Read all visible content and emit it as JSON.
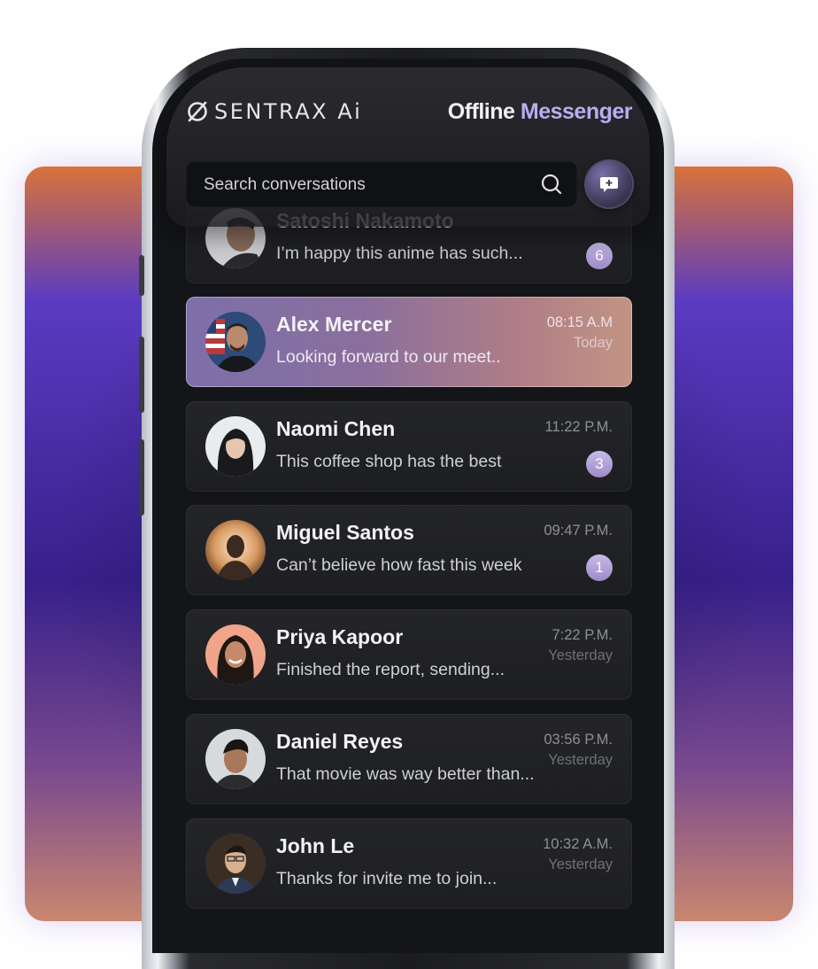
{
  "header": {
    "brand": "SENTRAX Ai",
    "title_part1": "Offline",
    "title_part2": "Messenger"
  },
  "search": {
    "placeholder": "Search conversations"
  },
  "compose": {
    "icon": "chat-plus-icon"
  },
  "colors": {
    "accent": "#b7aef0",
    "badge": "#b3a2d8",
    "active_from": "#7d6faa",
    "active_to": "#c29484"
  },
  "conversations": [
    {
      "name": "Satoshi Nakamoto",
      "message": "I’m happy this anime has such...",
      "time": "",
      "day": "",
      "badge": "6"
    },
    {
      "name": "Alex Mercer",
      "message": "Looking forward to our meet..",
      "time": "08:15 A.M",
      "day": "Today",
      "badge": ""
    },
    {
      "name": "Naomi Chen",
      "message": "This coffee shop has the best",
      "time": "11:22 P.M.",
      "day": "",
      "badge": "3"
    },
    {
      "name": "Miguel Santos",
      "message": "Can’t believe how fast this week",
      "time": "09:47 P.M.",
      "day": "",
      "badge": "1"
    },
    {
      "name": "Priya Kapoor",
      "message": "Finished the report, sending...",
      "time": "7:22 P.M.",
      "day": "Yesterday",
      "badge": ""
    },
    {
      "name": "Daniel Reyes",
      "message": "That movie was way better than...",
      "time": "03:56 P.M.",
      "day": "Yesterday",
      "badge": ""
    },
    {
      "name": "John Le",
      "message": "Thanks for invite me to join...",
      "time": "10:32 A.M.",
      "day": "Yesterday",
      "badge": ""
    }
  ]
}
